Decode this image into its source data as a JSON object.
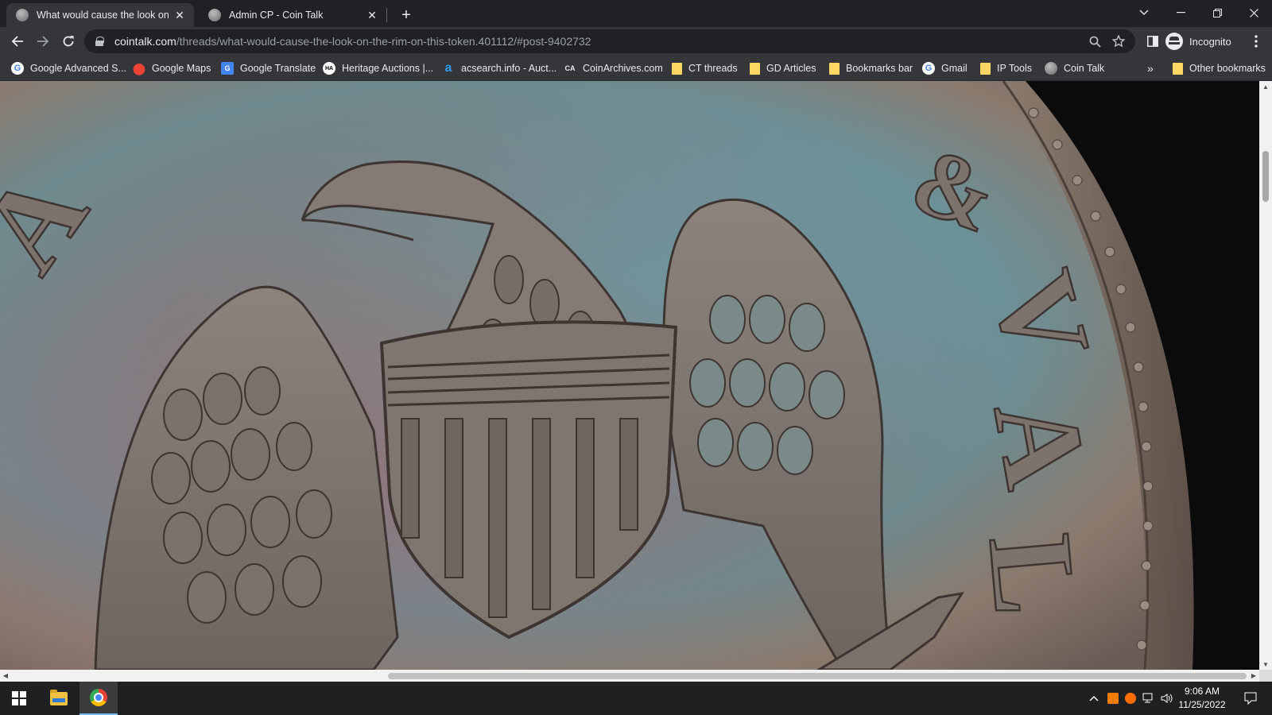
{
  "tabs": [
    {
      "title": "What would cause the look on th",
      "active": true
    },
    {
      "title": "Admin CP - Coin Talk",
      "active": false
    }
  ],
  "toolbar": {
    "url_host": "cointalk.com",
    "url_path": "/threads/what-would-cause-the-look-on-the-rim-on-this-token.401112/#post-9402732",
    "profile_label": "Incognito"
  },
  "bookmarks": [
    {
      "label": "Google Advanced S...",
      "icon": "google-icon"
    },
    {
      "label": "Google Maps",
      "icon": "maps-pin-icon"
    },
    {
      "label": "Google Translate",
      "icon": "translate-icon"
    },
    {
      "label": "Heritage Auctions |...",
      "icon": "heritage-icon"
    },
    {
      "label": "acsearch.info - Auct...",
      "icon": "acsearch-icon"
    },
    {
      "label": "CoinArchives.com",
      "icon": "coinarchives-icon"
    },
    {
      "label": "CT threads",
      "icon": "folder-icon"
    },
    {
      "label": "GD Articles",
      "icon": "folder-icon"
    },
    {
      "label": "Bookmarks bar",
      "icon": "folder-icon"
    },
    {
      "label": "Gmail",
      "icon": "google-icon"
    },
    {
      "label": "IP Tools",
      "icon": "folder-icon"
    },
    {
      "label": "Coin Talk",
      "icon": "cointalk-icon"
    }
  ],
  "bookmarks_overflow": "»",
  "other_bookmarks": "Other bookmarks",
  "content": {
    "coin_letters": [
      "A",
      "&",
      "V",
      "A",
      "L"
    ]
  },
  "taskbar": {
    "time": "9:06 AM",
    "date": "11/25/2022"
  }
}
